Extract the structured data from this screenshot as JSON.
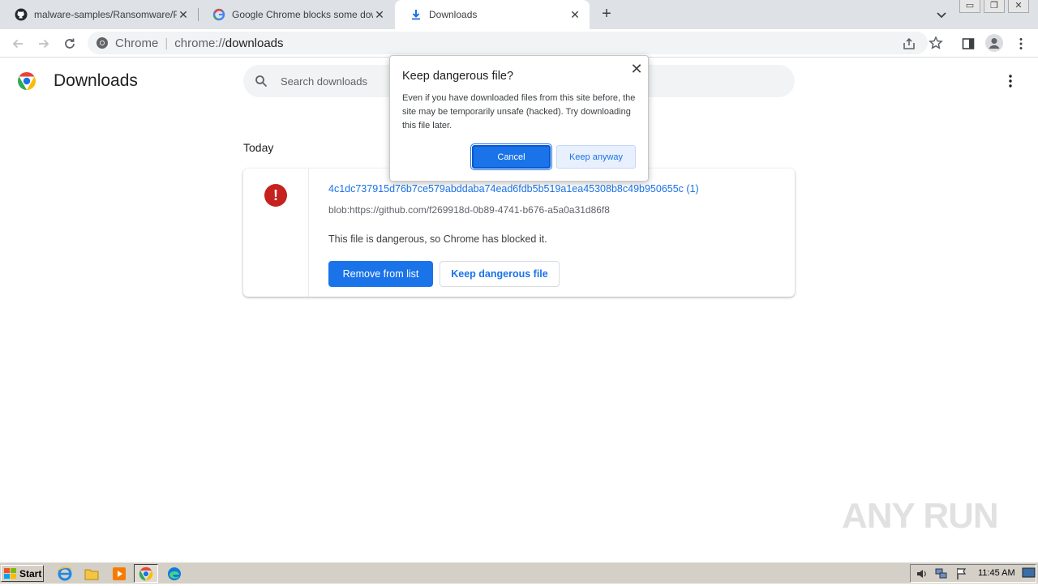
{
  "tabs": [
    {
      "title": "malware-samples/Ransomware/Petya",
      "icon": "github-icon"
    },
    {
      "title": "Google Chrome blocks some downloads",
      "icon": "google-icon"
    },
    {
      "title": "Downloads",
      "icon": "download-icon",
      "active": true
    }
  ],
  "omnibox": {
    "site_label": "Chrome",
    "url_scheme": "chrome://",
    "url_host": "downloads"
  },
  "page": {
    "title": "Downloads",
    "search_placeholder": "Search downloads",
    "section": "Today"
  },
  "download": {
    "file_name": "4c1dc737915d76b7ce579abddaba74ead6fdb5b519a1ea45308b8c49b950655c (1)",
    "source_url": "blob:https://github.com/f269918d-0b89-4741-b676-a5a0a31d86f8",
    "status": "This file is dangerous, so Chrome has blocked it.",
    "remove_label": "Remove from list",
    "keep_label": "Keep dangerous file"
  },
  "dialog": {
    "title": "Keep dangerous file?",
    "body": "Even if you have downloaded files from this site before, the site may be temporarily unsafe (hacked). Try downloading this file later.",
    "cancel_label": "Cancel",
    "keep_label": "Keep anyway"
  },
  "watermark": "ANY RUN",
  "taskbar": {
    "start_label": "Start",
    "clock": "11:45 AM"
  },
  "colors": {
    "accent": "#1a73e8",
    "danger": "#c5221f"
  }
}
